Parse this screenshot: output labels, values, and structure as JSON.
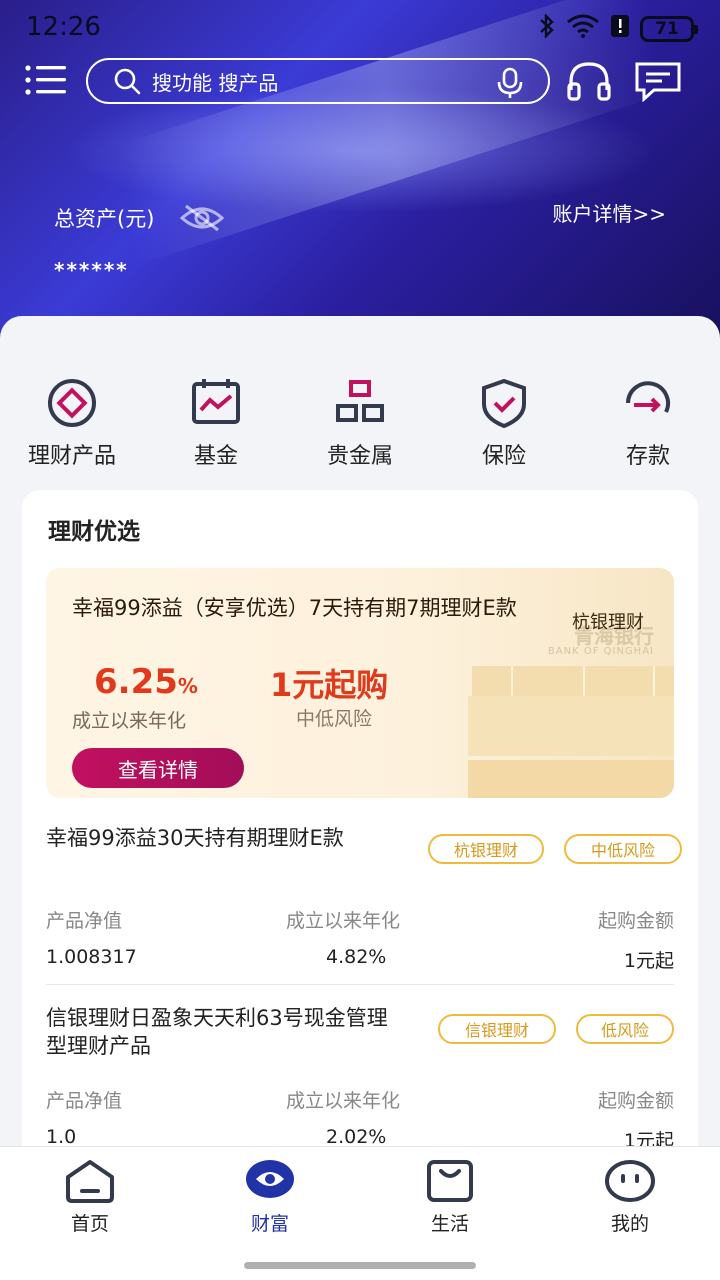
{
  "status_bar": {
    "time": "12:26",
    "battery": "71",
    "icons": [
      "bluetooth-icon",
      "wifi-icon",
      "alert-icon",
      "battery-icon"
    ]
  },
  "header": {
    "search_placeholder": "搜功能 搜产品",
    "total_assets_label": "总资产(元)",
    "account_detail_link": "账户详情>>",
    "assets_value": "******"
  },
  "quick_links": [
    {
      "label": "理财产品",
      "icon": "wealth-product-icon"
    },
    {
      "label": "基金",
      "icon": "fund-icon"
    },
    {
      "label": "贵金属",
      "icon": "precious-metal-icon"
    },
    {
      "label": "保险",
      "icon": "insurance-icon"
    },
    {
      "label": "存款",
      "icon": "deposit-icon"
    }
  ],
  "section": {
    "title": "理财优选"
  },
  "featured": {
    "name": "幸福99添益（安享优选）7天持有期7期理财E款",
    "brand": "杭银理财",
    "watermark": "青海银行",
    "watermark_sub": "BANK OF QINGHAI",
    "rate": "6.25",
    "rate_unit": "%",
    "rate_label": "成立以来年化",
    "min_buy": "1元起购",
    "risk": "中低风险",
    "button": "查看详情"
  },
  "products": [
    {
      "title": "幸福99添益30天持有期理财E款",
      "tags": [
        "杭银理财",
        "中低风险"
      ],
      "col_heads": [
        "产品净值",
        "成立以来年化",
        "起购金额"
      ],
      "values": [
        "1.008317",
        "4.82%",
        "1元起"
      ]
    },
    {
      "title": "信银理财日盈象天天利63号现金管理型理财产品",
      "tags": [
        "信银理财",
        "低风险"
      ],
      "col_heads": [
        "产品净值",
        "成立以来年化",
        "起购金额"
      ],
      "values": [
        "1.0",
        "2.02%",
        "1元起"
      ]
    }
  ],
  "bottom_nav": [
    {
      "label": "首页",
      "icon": "home-icon"
    },
    {
      "label": "财富",
      "icon": "wealth-icon",
      "active": true
    },
    {
      "label": "生活",
      "icon": "life-bag-icon"
    },
    {
      "label": "我的",
      "icon": "profile-face-icon"
    }
  ],
  "colors": {
    "accent": "#2233a8",
    "rate_red": "#e03a1d",
    "button_magenta": "#b40f5c",
    "tag_gold": "#d69a1c"
  }
}
